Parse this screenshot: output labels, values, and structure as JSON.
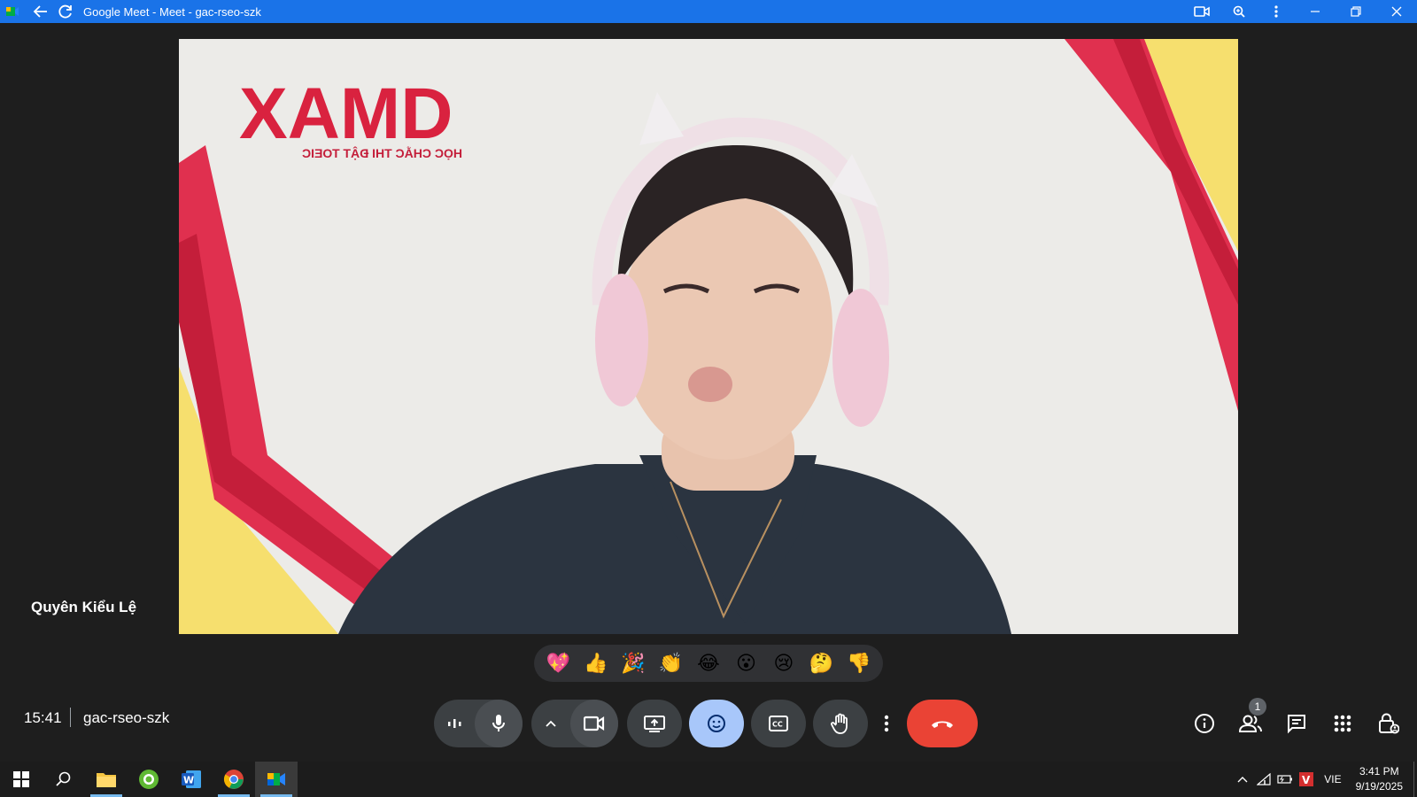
{
  "window": {
    "title": "Google Meet - Meet - gac-rseo-szk"
  },
  "video": {
    "background_logo_text": "XAMD",
    "background_tagline": "HỌC CHẮC THI ĐẬT TOEIC",
    "participant_name": "Quyên Kiểu Lệ"
  },
  "reactions": [
    {
      "glyph": "💖",
      "name": "sparkling-heart"
    },
    {
      "glyph": "👍",
      "name": "thumbs-up"
    },
    {
      "glyph": "🎉",
      "name": "party-popper"
    },
    {
      "glyph": "👏",
      "name": "clapping-hands"
    },
    {
      "glyph": "😂",
      "name": "tears-of-joy"
    },
    {
      "glyph": "😮",
      "name": "surprised"
    },
    {
      "glyph": "😢",
      "name": "crying"
    },
    {
      "glyph": "🤔",
      "name": "thinking"
    },
    {
      "glyph": "👎",
      "name": "thumbs-down"
    }
  ],
  "meeting": {
    "time": "15:41",
    "code": "gac-rseo-szk"
  },
  "people_count": "1",
  "taskbar": {
    "time": "3:41 PM",
    "date": "9/19/2025",
    "language": "VIE"
  },
  "colors": {
    "titlebar": "#1a73e8",
    "end_call": "#ea4335",
    "active_control": "#a8c7fa",
    "background": "#202124"
  }
}
